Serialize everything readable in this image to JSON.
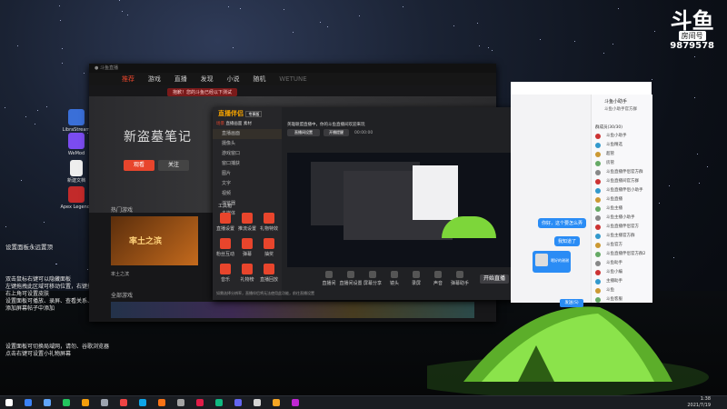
{
  "douyu": {
    "logo": "斗鱼",
    "tag": "房间号",
    "room": "9879578"
  },
  "desktop_icons": [
    {
      "label": "LibraStream",
      "color": "#3a6fd8"
    },
    {
      "label": "WeMod",
      "color": "#7b4cf0"
    },
    {
      "label": "新建文档",
      "color": "#f3f3f3"
    },
    {
      "label": "Apex Legends",
      "color": "#c22a2a"
    }
  ],
  "overlay": {
    "line1": "设置面板永远置顶",
    "block2": "双击鼠标右键可以隐藏面板\n左键拖拽此区域可移动位置，右键拖拽可调整面板大小\n右上角可设置皮肤\n设置面板可播放、录屏、查看关系、鼠标悬停查看\n添加屏幕帖子中添加",
    "block3": "设置面板可切换局域网，请勿、谷歌浏览器\n点击右键可设置小礼物屏幕"
  },
  "main_window": {
    "tabs": [
      "推荐",
      "游戏",
      "直播",
      "发现",
      "小说",
      "随机",
      "WETUNE"
    ],
    "notice": "抱歉！您的斗鱼已经以下测试",
    "title": "新盗墓笔记",
    "btn1": "观看",
    "btn2": "关注",
    "section1": "热门游戏",
    "section2": "全部游戏",
    "game_name": "率土之滨",
    "game_user": "率土之滨"
  },
  "live_client": {
    "logo": "直播伴侣",
    "tag": "专享版",
    "tabs": [
      "场景",
      "直播画面",
      "素材",
      "音频"
    ],
    "sidebar": [
      "直播画面",
      "摄像头",
      "游戏窗口",
      "窗口捕获",
      "图片",
      "文字",
      "视频",
      "浏览器",
      "多媒体"
    ],
    "tools_title": "工具箱",
    "tools": [
      "直播设置",
      "推流设置",
      "礼物特效",
      "粉丝互动",
      "弹幕",
      "抽奖",
      "音乐",
      "礼物榜",
      "直播回放"
    ],
    "room_title": "英雄联盟直播中，你的斗鱼直播间欢迎来玩",
    "room_btn1": "直播间设置",
    "room_btn2": "开播提醒",
    "status": "00:00:00",
    "bottom_tools": [
      "直播间",
      "直播间设置",
      "屏幕分享",
      "镜头",
      "录屏",
      "声音",
      "弹幕助手"
    ],
    "start": "开始直播",
    "footer": "如需选择分辨率，直播伴侣将无法使用此功能，前往直播设置"
  },
  "chat": {
    "name": "斗鱼小助手",
    "group": "斗鱼小助手官方群",
    "members_title": "群成员(30/30)",
    "members": [
      "斗鱼小助手",
      "斗鱼精选",
      "超管",
      "房管",
      "斗鱼直播伴侣官方群",
      "斗鱼直播间官方群",
      "斗鱼直播伴侣小助手",
      "斗鱼直播",
      "斗鱼主播",
      "斗鱼主播小助手",
      "斗鱼直播伴侣官方",
      "斗鱼主播官方群",
      "斗鱼官方",
      "斗鱼直播伴侣官方群2",
      "斗鱼助手",
      "斗鱼小编",
      "主播助手",
      "斗鱼",
      "斗鱼客服"
    ],
    "bubble1": "你好，这个要怎么弄",
    "bubble2": "我知道了",
    "bubble3": "嗯好的谢谢",
    "send": "发送(S)"
  },
  "taskbar": {
    "time": "1:38",
    "date": "2021/7/19"
  },
  "colors": {
    "accent": "#e8452c",
    "chat_blue": "#2a8cf5",
    "tent_green": "#7dd63a"
  }
}
